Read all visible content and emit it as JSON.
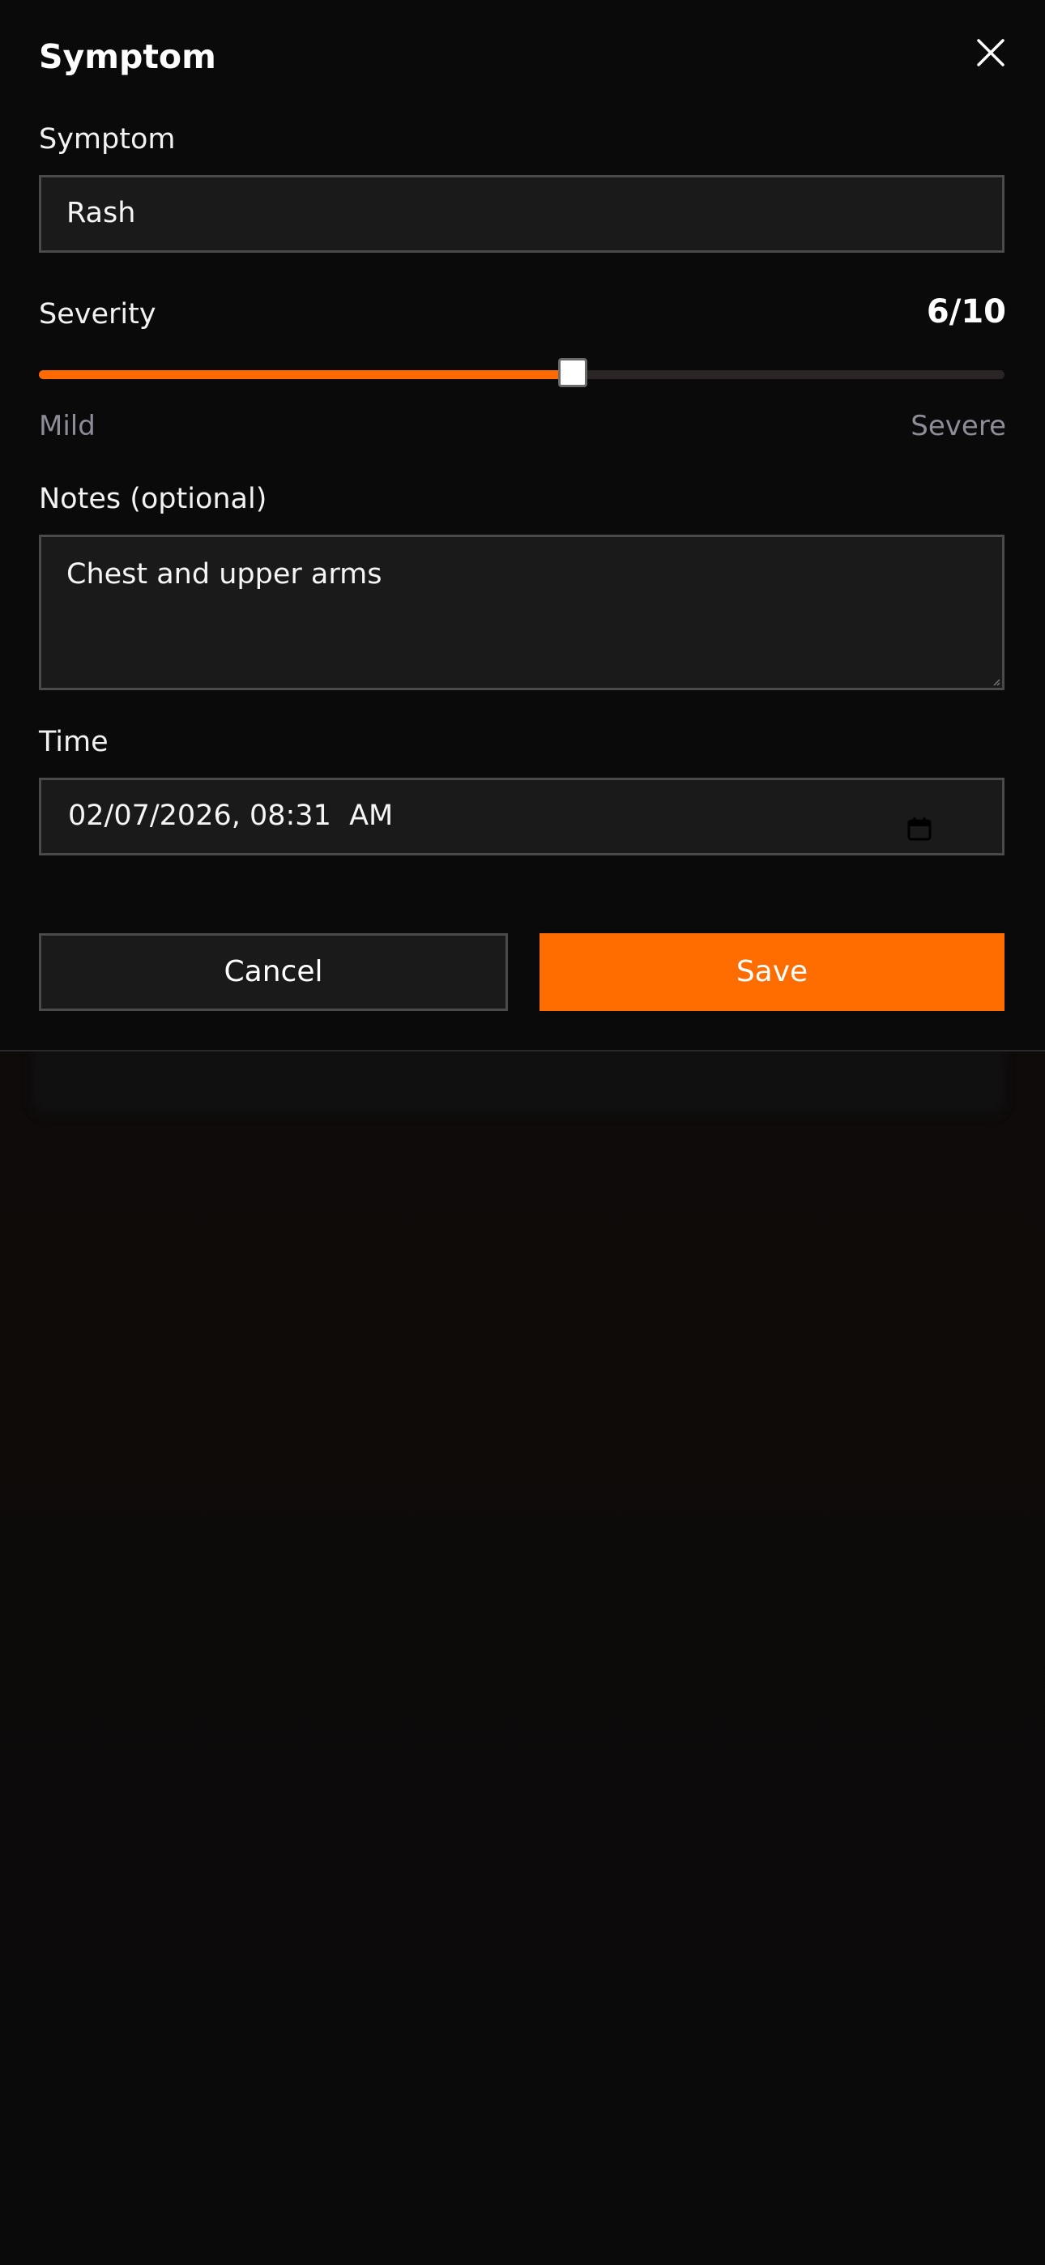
{
  "modal": {
    "title": "Symptom",
    "close_icon": "close-icon"
  },
  "symptom": {
    "label": "Symptom",
    "value": "Rash"
  },
  "severity": {
    "label": "Severity",
    "display": "6/10",
    "value": 6,
    "max": 10,
    "fraction": 0.553,
    "min_label": "Mild",
    "max_label": "Severe"
  },
  "notes": {
    "label": "Notes (optional)",
    "value": "Chest and upper arms"
  },
  "time": {
    "label": "Time",
    "value": "02/07/2026, 08:31  AM",
    "icon": "calendar-icon"
  },
  "actions": {
    "cancel_label": "Cancel",
    "save_label": "Save"
  },
  "colors": {
    "accent": "#ff6d00",
    "background": "#0a0a0b",
    "field_bg": "#1b1a1b",
    "muted_text": "#8e8c97"
  }
}
